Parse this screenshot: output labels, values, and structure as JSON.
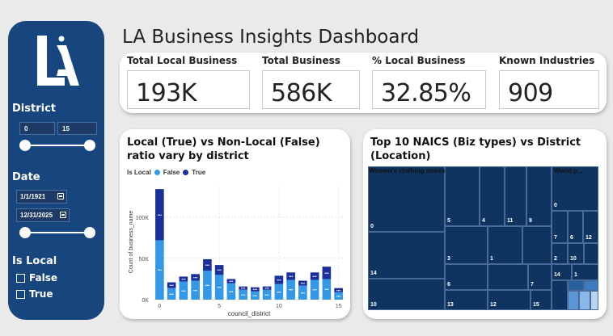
{
  "title": "LA Business Insights Dashboard",
  "sidebar": {
    "district_label": "District",
    "district_min": "0",
    "district_max": "15",
    "date_label": "Date",
    "date_start": "1/1/1921",
    "date_end": "12/31/2025",
    "is_local_label": "Is Local",
    "options": [
      "False",
      "True"
    ]
  },
  "kpis": [
    {
      "title": "Total Local Business",
      "value": "193K"
    },
    {
      "title": "Total Business",
      "value": "586K"
    },
    {
      "title": "% Local Business",
      "value": "32.85%"
    },
    {
      "title": "Known Industries",
      "value": "909"
    }
  ],
  "bar_chart": {
    "title_line1": "Local (True) vs Non-Local (False)",
    "title_line2": "ratio vary by district",
    "legend_title": "Is Local",
    "false_color": "#3399e6",
    "true_color": "#1a2f9c"
  },
  "chart_data": {
    "type": "bar",
    "stacked": true,
    "categories": [
      0,
      1,
      2,
      3,
      4,
      5,
      6,
      7,
      8,
      9,
      10,
      11,
      12,
      13,
      14,
      15
    ],
    "series": [
      {
        "name": "False",
        "values": [
          72000,
          14000,
          22000,
          23000,
          35000,
          30000,
          20000,
          12000,
          10000,
          12000,
          19000,
          24000,
          17000,
          24000,
          25000,
          9000
        ]
      },
      {
        "name": "True",
        "values": [
          62000,
          7000,
          6000,
          8000,
          14000,
          12000,
          5000,
          4000,
          5000,
          4000,
          10000,
          9000,
          6000,
          9000,
          15000,
          5000
        ]
      }
    ],
    "xlabel": "council_district",
    "ylabel": "Count of business_name",
    "ylim": [
      0,
      140000
    ],
    "yticks": [
      "0K",
      "50K",
      "100K"
    ],
    "xticks": [
      "0",
      "5",
      "10",
      "15"
    ],
    "grid": true
  },
  "treemap": {
    "title_line1": "Top 10 NAICS (Biz types) vs District",
    "title_line2": "(Location)",
    "group1": "Women's clothing stores",
    "group2": "Wood p...",
    "labels": {
      "a0": "0",
      "a14": "14",
      "a10": "10",
      "b5": "5",
      "b4": "4",
      "b11": "11",
      "b9": "9",
      "b3": "3",
      "b1": "1",
      "b6": "6",
      "b7": "7",
      "b13": "13",
      "b12": "12",
      "b15": "15",
      "c0": "0",
      "c7": "7",
      "c6": "6",
      "c12": "12",
      "c2": "2",
      "c10": "10",
      "c14": "14",
      "c1": "1"
    }
  }
}
